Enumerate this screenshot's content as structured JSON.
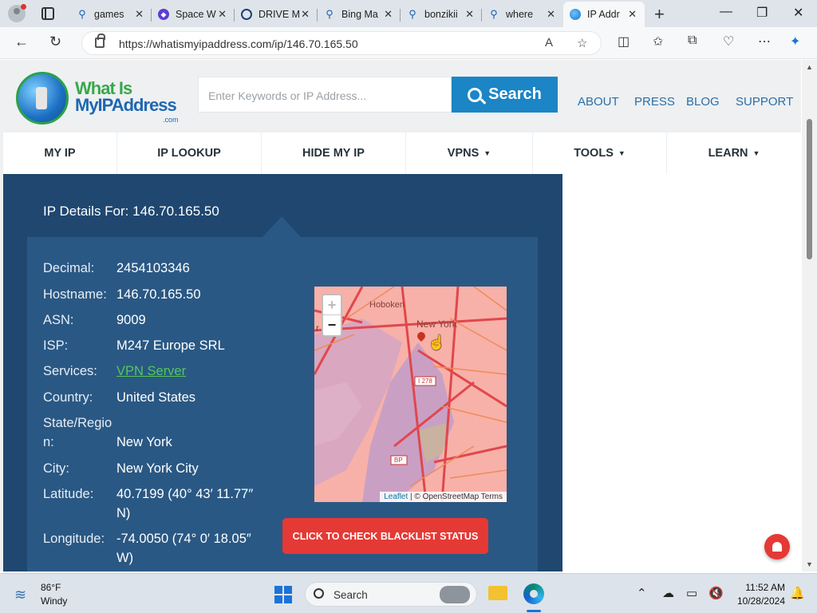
{
  "browser": {
    "tabs": [
      {
        "title": "games",
        "icon": "search-icon"
      },
      {
        "title": "Space W",
        "icon": "app-icon"
      },
      {
        "title": "DRIVE M",
        "icon": "drive-icon"
      },
      {
        "title": "Bing Ma",
        "icon": "search-icon"
      },
      {
        "title": "bonzikii",
        "icon": "search-icon"
      },
      {
        "title": "where",
        "icon": "search-icon"
      },
      {
        "title": "IP Addr",
        "icon": "globe-icon",
        "active": true
      }
    ],
    "url": "https://whatismyipaddress.com/ip/146.70.165.50"
  },
  "site": {
    "logo": {
      "line1": "What Is",
      "line2": "MyIPAddress",
      "suffix": ".com"
    },
    "search_placeholder": "Enter Keywords or IP Address...",
    "search_button": "Search",
    "top_links": [
      "ABOUT",
      "PRESS",
      "BLOG",
      "SUPPORT"
    ],
    "nav": [
      {
        "label": "MY IP",
        "dropdown": false
      },
      {
        "label": "IP LOOKUP",
        "dropdown": false
      },
      {
        "label": "HIDE MY IP",
        "dropdown": false
      },
      {
        "label": "VPNS",
        "dropdown": true
      },
      {
        "label": "TOOLS",
        "dropdown": true
      },
      {
        "label": "LEARN",
        "dropdown": true
      }
    ]
  },
  "ip_details": {
    "title": "IP Details For: 146.70.165.50",
    "rows": [
      {
        "label": "Decimal:",
        "value": "2454103346"
      },
      {
        "label": "Hostname:",
        "value": "146.70.165.50"
      },
      {
        "label": "ASN:",
        "value": "9009"
      },
      {
        "label": "ISP:",
        "value": "M247 Europe SRL"
      },
      {
        "label": "Services:",
        "value": "VPN Server"
      },
      {
        "label": "Country:",
        "value": "United States"
      },
      {
        "label": "State/Region:",
        "value": "New York"
      },
      {
        "label": "City:",
        "value": "New York City"
      },
      {
        "label": "Latitude:",
        "value": "40.7199  (40° 43′ 11.77″ N)"
      },
      {
        "label": "Longitude:",
        "value": "-74.0050  (74° 0′ 18.05″ W)"
      }
    ],
    "blacklist_button": "CLICK TO CHECK BLACKLIST STATUS"
  },
  "map": {
    "labels": {
      "hoboken": "Hoboken",
      "city": "r City",
      "newyork": "New York",
      "i278": "I 278",
      "bp": "BP"
    },
    "zoom_in": "+",
    "zoom_out": "−",
    "attribution_leaflet": "Leaflet",
    "attribution_rest": " | © OpenStreetMap Terms"
  },
  "taskbar": {
    "weather_temp": "86°F",
    "weather_desc": "Windy",
    "search_label": "Search",
    "time": "11:52 AM",
    "date": "10/28/2024"
  },
  "colors": {
    "panel": "#1f4770",
    "card": "#2a5884",
    "search_button": "#1b85c6",
    "blacklist_button": "#e53935",
    "link_green": "#52c85a"
  }
}
